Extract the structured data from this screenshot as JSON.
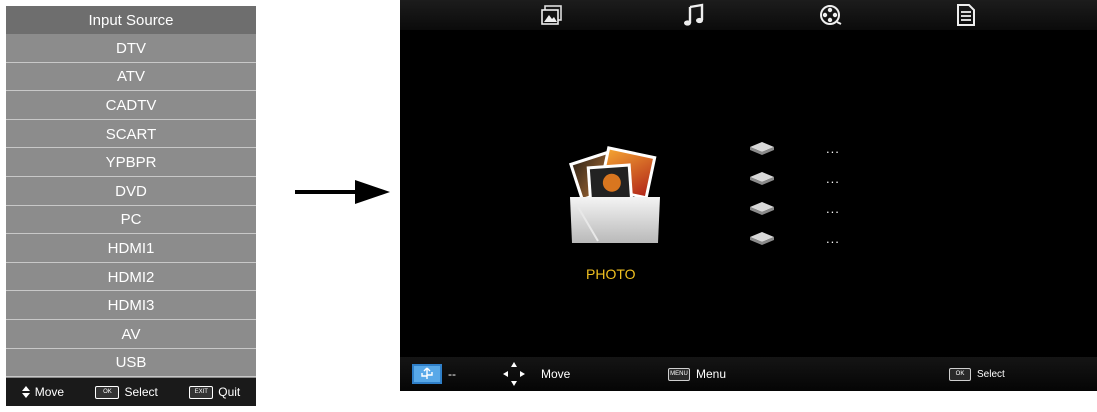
{
  "input_source": {
    "title": "Input Source",
    "items": [
      "DTV",
      "ATV",
      "CADTV",
      "SCART",
      "YPBPR",
      "DVD",
      "PC",
      "HDMI1",
      "HDMI2",
      "HDMI3",
      "AV",
      "USB"
    ],
    "footer": {
      "move_label": "Move",
      "select_label": "Select",
      "select_key": "OK",
      "quit_label": "Quit",
      "quit_key": "EXIT"
    }
  },
  "media_player": {
    "tabs": [
      "photo-tab-icon",
      "music-tab-icon",
      "movie-tab-icon",
      "text-tab-icon"
    ],
    "selected_item_label": "PHOTO",
    "devices": [
      "...",
      "...",
      "...",
      "..."
    ],
    "bottom_bar": {
      "usb_status": "--",
      "move_label": "Move",
      "menu_key": "MENU",
      "menu_label": "Menu",
      "select_key": "OK",
      "select_label": "Select"
    },
    "colors": {
      "label_accent": "#f0c020",
      "background": "#000000"
    }
  }
}
